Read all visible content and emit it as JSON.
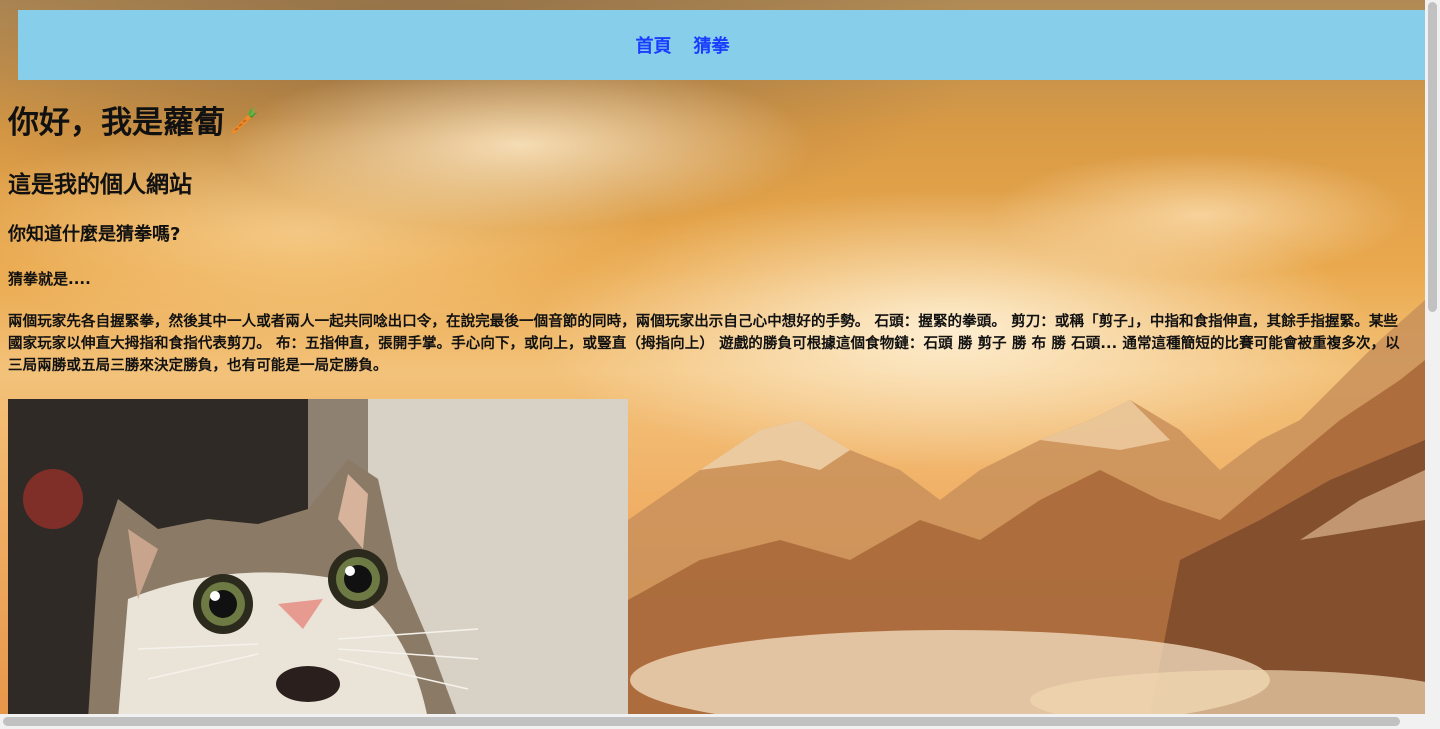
{
  "nav": {
    "items": [
      {
        "label": "首頁"
      },
      {
        "label": "猜拳"
      }
    ]
  },
  "main": {
    "title": "你好，我是蘿蔔",
    "title_icon": "carrot-icon",
    "subtitle": "這是我的個人網站",
    "question": "你知道什麼是猜拳嗎?",
    "lead": "猜拳就是....",
    "paragraph": "兩個玩家先各自握緊拳，然後其中一人或者兩人一起共同唸出口令，在說完最後一個音節的同時，兩個玩家出示自己心中想好的手勢。 石頭：握緊的拳頭。 剪刀：或稱「剪子」，中指和食指伸直，其餘手指握緊。某些國家玩家以伸直大拇指和食指代表剪刀。 布：五指伸直，張開手掌。手心向下，或向上，或豎直（拇指向上） 遊戲的勝負可根據這個食物鏈：石頭 勝 剪子 勝 布 勝 石頭... 通常這種簡短的比賽可能會被重複多次，以三局兩勝或五局三勝來決定勝負，也有可能是一局定勝負。",
    "photo": "surprised-cat-photo"
  },
  "background": "mountain-sunset-photo",
  "colors": {
    "nav_bg": "#87ceeb",
    "nav_link": "#1a3cff"
  }
}
